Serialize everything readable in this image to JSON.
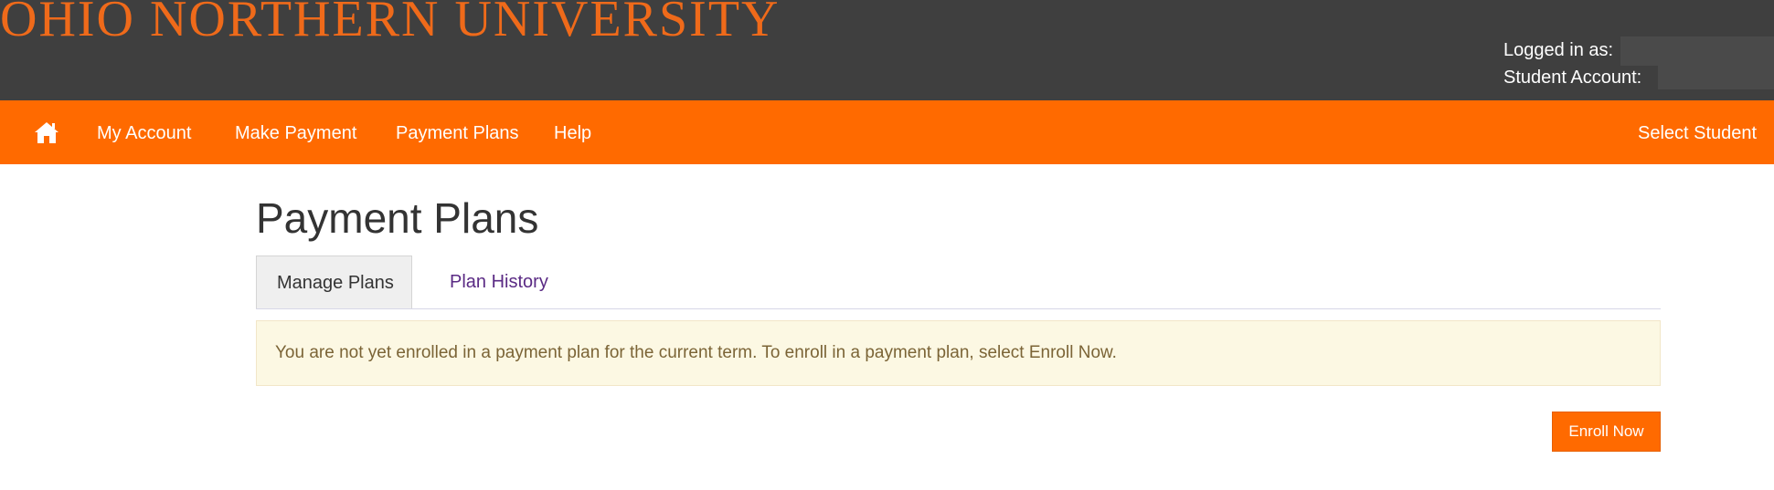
{
  "header": {
    "university_name": "OHIO NORTHERN UNIVERSITY",
    "logged_in_label": "Logged in as:",
    "student_account_label": "Student Account:"
  },
  "nav": {
    "home_icon": "home-icon",
    "items": [
      {
        "label": "My Account"
      },
      {
        "label": "Make Payment"
      },
      {
        "label": "Payment Plans"
      },
      {
        "label": "Help"
      }
    ],
    "right_label": "Select Student"
  },
  "main": {
    "title": "Payment Plans",
    "tabs": [
      {
        "label": "Manage Plans",
        "active": true
      },
      {
        "label": "Plan History",
        "active": false
      }
    ],
    "notice": "You are not yet enrolled in a payment plan for the current term. To enroll in a payment plan, select Enroll Now.",
    "enroll_button": "Enroll Now"
  },
  "colors": {
    "header_bg": "#3f3f3f",
    "brand_orange": "#ef6a1a",
    "nav_bg": "#ff6a00",
    "notice_bg": "#fcf8e3",
    "tab_link": "#5a2a84"
  }
}
